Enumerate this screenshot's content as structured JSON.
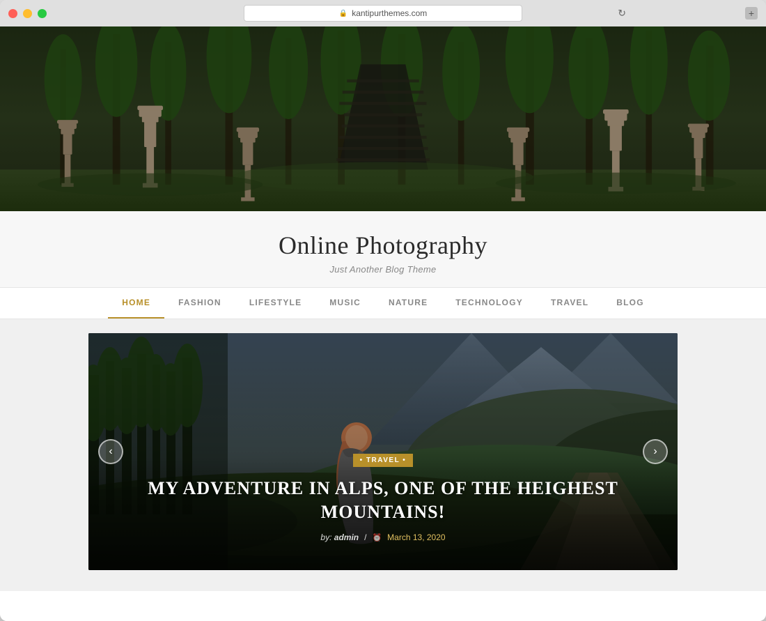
{
  "window": {
    "url": "kantipurthemes.com",
    "new_tab_icon": "+"
  },
  "site": {
    "title": "Online Photography",
    "tagline": "Just Another Blog Theme"
  },
  "nav": {
    "items": [
      {
        "label": "HOME",
        "active": true
      },
      {
        "label": "FASHION",
        "active": false
      },
      {
        "label": "LIFESTYLE",
        "active": false
      },
      {
        "label": "MUSIC",
        "active": false
      },
      {
        "label": "NATURE",
        "active": false
      },
      {
        "label": "TECHNOLOGY",
        "active": false
      },
      {
        "label": "TRAVEL",
        "active": false
      },
      {
        "label": "BLOG",
        "active": false
      }
    ]
  },
  "slider": {
    "prev_arrow": "‹",
    "next_arrow": "›",
    "slide": {
      "category": "TRAVEL",
      "title": "MY ADVENTURE IN ALPS, ONE OF THE HEIGHEST MOUNTAINS!",
      "author_label": "by:",
      "author": "admin",
      "separator": "/",
      "date": "March 13, 2020"
    }
  }
}
